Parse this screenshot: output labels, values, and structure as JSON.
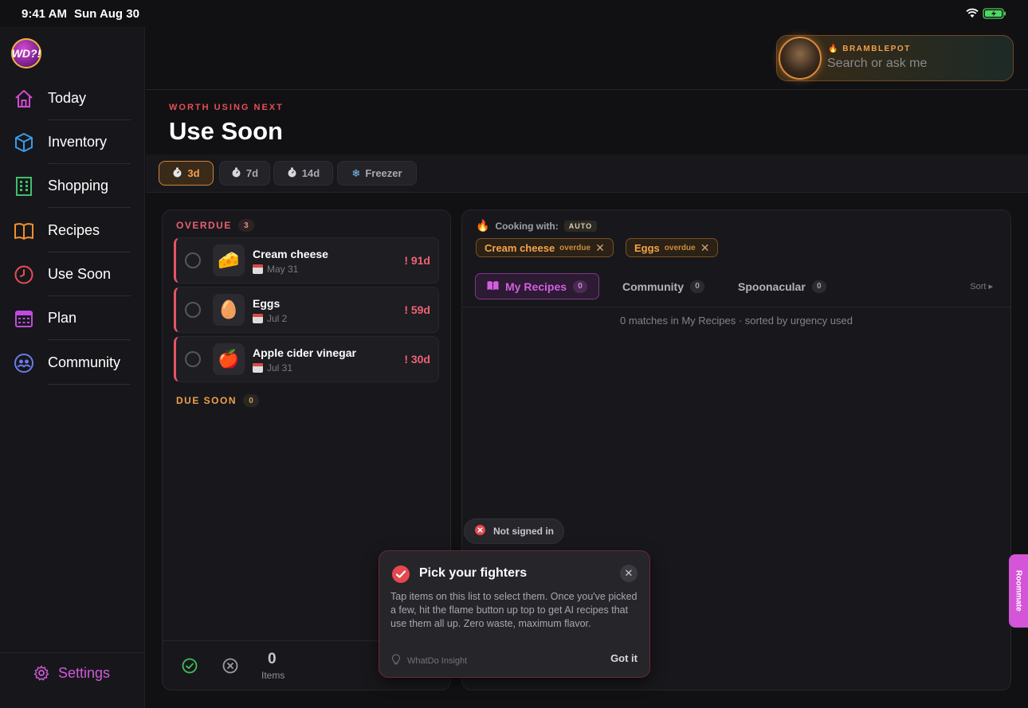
{
  "status_bar": {
    "time": "9:41 AM",
    "date": "Sun Aug 30"
  },
  "app": {
    "logo_text": "WD?!"
  },
  "sidebar": {
    "items": [
      {
        "label": "Today",
        "icon": "home-icon"
      },
      {
        "label": "Inventory",
        "icon": "box-icon"
      },
      {
        "label": "Shopping",
        "icon": "building-icon"
      },
      {
        "label": "Recipes",
        "icon": "book-icon"
      },
      {
        "label": "Use Soon",
        "icon": "clock-icon"
      },
      {
        "label": "Plan",
        "icon": "calendar-icon"
      },
      {
        "label": "Community",
        "icon": "people-icon"
      }
    ],
    "settings_label": "Settings"
  },
  "assistant": {
    "name": "BRAMBLEPOT",
    "placeholder": "Search or ask me"
  },
  "page": {
    "eyebrow": "WORTH USING NEXT",
    "title": "Use Soon"
  },
  "filters": [
    {
      "label": "3d",
      "icon": "timer-icon",
      "active": true
    },
    {
      "label": "7d",
      "icon": "timer-icon",
      "active": false
    },
    {
      "label": "14d",
      "icon": "timer-icon",
      "active": false
    },
    {
      "label": "Freezer",
      "icon": "snowflake-icon",
      "active": false
    }
  ],
  "overdue": {
    "label": "OVERDUE",
    "count": "3",
    "items": [
      {
        "name": "Cream cheese",
        "date": "May 31",
        "age": "! 91d",
        "emoji": "🧀"
      },
      {
        "name": "Eggs",
        "date": "Jul 2",
        "age": "! 59d",
        "emoji": "🥚"
      },
      {
        "name": "Apple cider vinegar",
        "date": "Jul 31",
        "age": "! 30d",
        "emoji": "🍎"
      }
    ]
  },
  "due_soon": {
    "label": "DUE SOON",
    "count": "0"
  },
  "selection_footer": {
    "count": "0",
    "unit": "Items"
  },
  "cooking": {
    "label": "Cooking with:",
    "mode": "AUTO",
    "selected": [
      {
        "name": "Cream cheese",
        "tag": "overdue"
      },
      {
        "name": "Eggs",
        "tag": "overdue"
      }
    ]
  },
  "recipe_tabs": [
    {
      "label": "My Recipes",
      "count": "0",
      "active": true
    },
    {
      "label": "Community",
      "count": "0",
      "active": false
    },
    {
      "label": "Spoonacular",
      "count": "0",
      "active": false
    }
  ],
  "sort_label": "Sort ▸",
  "matches_text": "0 matches in My Recipes · sorted by urgency used",
  "toast_not_signed_in": "Not signed in",
  "insight": {
    "title": "Pick your fighters",
    "body": "Tap items on this list to select them. Once you've picked a few, hit the flame button up top to get AI recipes that use them all up. Zero waste, maximum flavor.",
    "source": "WhatDo Insight",
    "action": "Got it"
  },
  "roommate_tab": "Roommate",
  "colors": {
    "accent_purple": "#d55ee0",
    "accent_orange": "#f4a44c",
    "overdue_red": "#e55563",
    "background": "#111114"
  }
}
